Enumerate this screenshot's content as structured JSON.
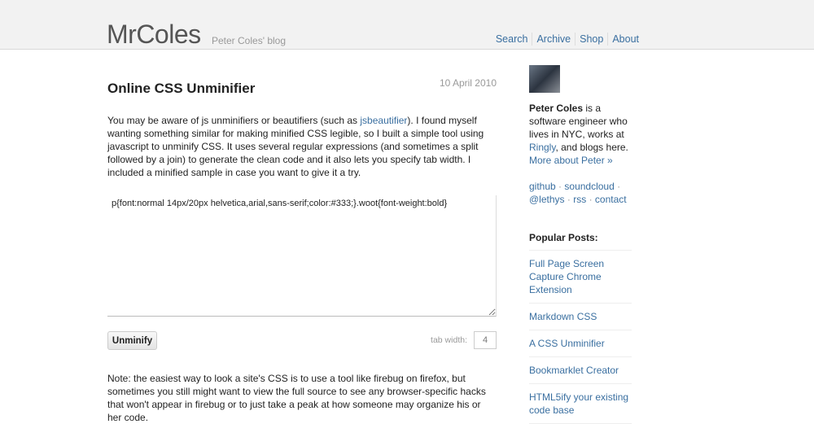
{
  "header": {
    "logo": "MrColes",
    "tagline": "Peter Coles' blog",
    "nav": [
      "Search",
      "Archive",
      "Shop",
      "About"
    ]
  },
  "post": {
    "title": "Online CSS Unminifier",
    "date": "10 April 2010",
    "intro_before": "You may be aware of js unminifiers or beautifiers (such as ",
    "intro_link": "jsbeautifier",
    "intro_after": "). I found myself wanting something similar for making minified CSS legible, so I built a simple tool using javascript to unminify CSS. It uses several regular expressions (and sometimes a split followed by a join) to generate the clean code and it also lets you specify tab width. I included a minified sample in case you want to give it a try.",
    "textarea_value": "p{font:normal 14px/20px helvetica,arial,sans-serif;color:#333;}.woot{font-weight:bold}",
    "button_label": "Unminify",
    "tab_width_label": "tab width:",
    "tab_width_value": "4",
    "note": "Note: the easiest way to look a site's CSS is to use a tool like firebug on firefox, but sometimes you still might want to view the full source to see any browser-specific hacks that won't appear in firebug or to just take a peak at how someone may organize his or her code."
  },
  "sidebar": {
    "bio_name": "Peter Coles",
    "bio_1": " is a software engineer who lives in NYC, works at ",
    "bio_link": "Ringly",
    "bio_2": ", and blogs here.",
    "more": "More about Peter »",
    "social": [
      "github",
      "soundcloud",
      "@lethys",
      "rss",
      "contact"
    ],
    "sep": "·",
    "popular_title": "Popular Posts:",
    "popular": [
      "Full Page Screen Capture Chrome Extension",
      "Markdown CSS",
      "A CSS Unminifier",
      "Bookmarklet Creator",
      "HTML5ify your existing code base"
    ]
  }
}
